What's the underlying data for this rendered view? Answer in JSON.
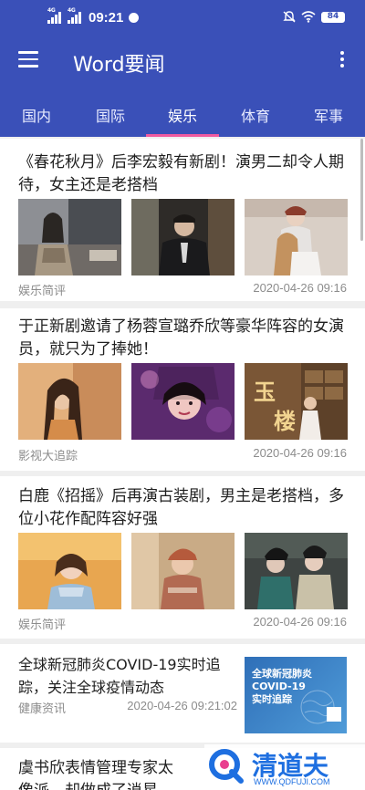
{
  "status_bar": {
    "time": "09:21",
    "sig1_label": "4G",
    "sig2_label": "4G",
    "battery": "84"
  },
  "app": {
    "title": "Word要闻",
    "menu_icon": "hamburger-menu-icon",
    "more_icon": "more-vertical-icon"
  },
  "tabs": [
    {
      "label": "国内",
      "active": false
    },
    {
      "label": "国际",
      "active": false
    },
    {
      "label": "娱乐",
      "active": true
    },
    {
      "label": "体育",
      "active": false
    },
    {
      "label": "军事",
      "active": false
    }
  ],
  "articles": [
    {
      "title": "《春花秋月》后李宏毅有新剧！演男二却令人期待，女主还是老搭档",
      "source": "娱乐简评",
      "time": "2020-04-26 09:16"
    },
    {
      "title": "于正新剧邀请了杨蓉宣璐乔欣等豪华阵容的女演员，就只为了捧她！",
      "source": "影视大追踪",
      "time": "2020-04-26 09:16",
      "image_text_1": "玉",
      "image_text_2": "楼"
    },
    {
      "title": "白鹿《招摇》后再演古装剧，男主是老搭档，多位小花作配阵容好强",
      "source": "娱乐简评",
      "time": "2020-04-26 09:16"
    },
    {
      "title": "全球新冠肺炎COVID-19实时追踪，关注全球疫情动态",
      "source": "健康资讯",
      "time": "2020-04-26 09:21:02",
      "banner_line1": "全球新冠肺炎",
      "banner_line2": "COVID-19",
      "banner_line3": "实时追踪"
    },
    {
      "title": "虞书欣表情管理专家太",
      "title_line2": "像派，却做成了逍星"
    }
  ],
  "watermark": {
    "name": "清道夫",
    "url": "WWW.QDFUJI.COM"
  },
  "colors": {
    "primary": "#3a50b8",
    "tab_indicator": "#f05aa0",
    "meta_text": "#8c8c8c"
  }
}
